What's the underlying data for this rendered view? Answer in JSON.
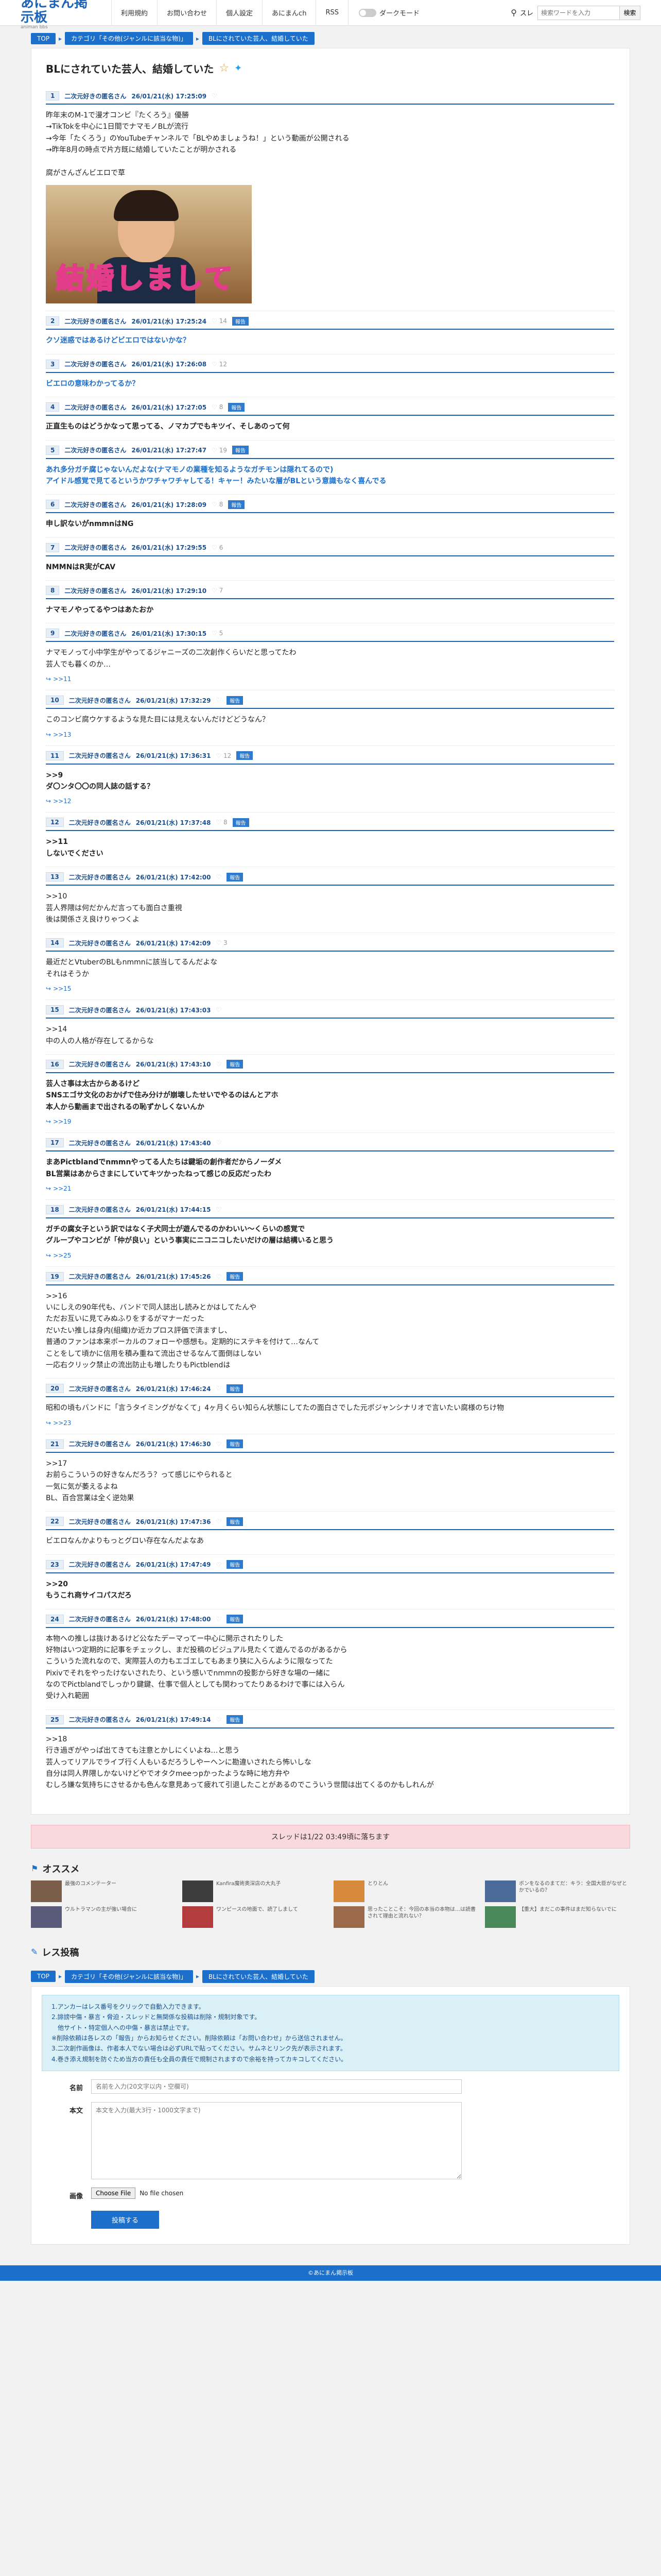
{
  "header": {
    "logo_main": "あにまん掲示板",
    "logo_sub": "animan bbs",
    "nav": [
      "利用規約",
      "お問い合わせ",
      "個人設定",
      "あにまんch",
      "RSS"
    ],
    "dark_mode_label": "ダークモード",
    "search_type": "スレ",
    "search_placeholder": "検索ワードを入力",
    "search_button": "検索"
  },
  "breadcrumb": [
    "TOP",
    "カテゴリ「その他(ジャンルに該当な物)」",
    "BLにされていた芸人、結婚していた"
  ],
  "thread": {
    "title": "BLにされていた芸人、結婚していた",
    "posts": [
      {
        "num": "1",
        "name": "二次元好きの匿名さん",
        "date": "26/01/21(水) 17:25:09",
        "likes": "",
        "tag": "",
        "style": "",
        "body": "昨年末のM-1で漫才コンビ『たくろう』優勝\n→TikTokを中心に1日間でナマモノBLが流行\n→今年「たくろう」のYouTubeチャンネルで「BLやめましょうね！」という動画が公開される\n→昨年8月の時点で片方既に結婚していたことが明かされる\n\n腐がさんざんビエロで草",
        "image": true,
        "image_caption": "結婚しまして",
        "replies": ""
      },
      {
        "num": "2",
        "name": "二次元好きの匿名さん",
        "date": "26/01/21(水) 17:25:24",
        "likes": "14",
        "tag": "報告",
        "style": "blue",
        "body": "クソ迷惑ではあるけどビエロではないかな？",
        "image": false,
        "replies": ""
      },
      {
        "num": "3",
        "name": "二次元好きの匿名さん",
        "date": "26/01/21(水) 17:26:08",
        "likes": "12",
        "tag": "",
        "style": "blue",
        "body": "ビエロの意味わかってるか？",
        "image": false,
        "replies": ""
      },
      {
        "num": "4",
        "name": "二次元好きの匿名さん",
        "date": "26/01/21(水) 17:27:05",
        "likes": "8",
        "tag": "報告",
        "style": "bold",
        "body": "正直生ものはどうかなって思ってる、ノマカプでもキツイ、そしあのって何",
        "image": false,
        "replies": ""
      },
      {
        "num": "5",
        "name": "二次元好きの匿名さん",
        "date": "26/01/21(水) 17:27:47",
        "likes": "19",
        "tag": "報告",
        "style": "blue",
        "body": "あれ多分ガチ腐じゃないんだよな(ナマモノの業種を知るようなガチモンは隠れてるので)\nアイドル感覚で見てるというかワチャワチャしてる！キャー！みたいな層がBLという意識もなく喜んでる",
        "image": false,
        "replies": ""
      },
      {
        "num": "6",
        "name": "二次元好きの匿名さん",
        "date": "26/01/21(水) 17:28:09",
        "likes": "8",
        "tag": "報告",
        "style": "bold",
        "body": "申し訳ないがnmmnはNG",
        "image": false,
        "replies": ""
      },
      {
        "num": "7",
        "name": "二次元好きの匿名さん",
        "date": "26/01/21(水) 17:29:55",
        "likes": "6",
        "tag": "",
        "style": "bold",
        "body": "NMMNはR実がCAV",
        "image": false,
        "replies": ""
      },
      {
        "num": "8",
        "name": "二次元好きの匿名さん",
        "date": "26/01/21(水) 17:29:10",
        "likes": "7",
        "tag": "",
        "style": "bold",
        "body": "ナマモノやってるやつはあたおか",
        "image": false,
        "replies": ""
      },
      {
        "num": "9",
        "name": "二次元好きの匿名さん",
        "date": "26/01/21(水) 17:30:15",
        "likes": "5",
        "tag": "",
        "style": "",
        "body": "ナマモノって小中学生がやってるジャニーズの二次創作くらいだと思ってたわ\n芸人でも暮くのか…",
        "image": false,
        "replies": ">>11"
      },
      {
        "num": "10",
        "name": "二次元好きの匿名さん",
        "date": "26/01/21(水) 17:32:29",
        "likes": "",
        "tag": "報告",
        "style": "",
        "body": "このコンビ腐ウケするような見た目には見えないんだけどどうなん？",
        "image": false,
        "replies": ">>13"
      },
      {
        "num": "11",
        "name": "二次元好きの匿名さん",
        "date": "26/01/21(水) 17:36:31",
        "likes": "12",
        "tag": "報告",
        "style": "bold",
        "body": ">>9\nダ〇ンタ〇〇の同人誌の話する？",
        "image": false,
        "replies": ">>12"
      },
      {
        "num": "12",
        "name": "二次元好きの匿名さん",
        "date": "26/01/21(水) 17:37:48",
        "likes": "8",
        "tag": "報告",
        "style": "bold",
        "body": ">>11\nしないでください",
        "image": false,
        "replies": ""
      },
      {
        "num": "13",
        "name": "二次元好きの匿名さん",
        "date": "26/01/21(水) 17:42:00",
        "likes": "",
        "tag": "報告",
        "style": "",
        "body": ">>10\n芸人界隈は何だかんだ言っても面白さ重視\n後は関係さえ良けりゃつくよ",
        "image": false,
        "replies": ""
      },
      {
        "num": "14",
        "name": "二次元好きの匿名さん",
        "date": "26/01/21(水) 17:42:09",
        "likes": "3",
        "tag": "",
        "style": "",
        "body": "最近だとVtuberのBLもnmmnに該当してるんだよな\nそれはそうか",
        "image": false,
        "replies": ">>15"
      },
      {
        "num": "15",
        "name": "二次元好きの匿名さん",
        "date": "26/01/21(水) 17:43:03",
        "likes": "",
        "tag": "",
        "style": "",
        "body": ">>14\n中の人の人格が存在してるからな",
        "image": false,
        "replies": ""
      },
      {
        "num": "16",
        "name": "二次元好きの匿名さん",
        "date": "26/01/21(水) 17:43:10",
        "likes": "",
        "tag": "報告",
        "style": "bold",
        "body": "芸人さ事は太古からあるけど\nSNSエゴサ文化のおかげで住み分けが崩壊したせいでやるのはんとアホ\n本人から動画まで出されるの恥ずかしくないんか",
        "image": false,
        "replies": ">>19"
      },
      {
        "num": "17",
        "name": "二次元好きの匿名さん",
        "date": "26/01/21(水) 17:43:40",
        "likes": "",
        "tag": "",
        "style": "bold",
        "body": "まあPictblandでnmmnやってる人たちは鍵垢の創作者だからノーダメ\nBL営業はあからさまにしていてキツかったねって感じの反応だったわ",
        "image": false,
        "replies": ">>21"
      },
      {
        "num": "18",
        "name": "二次元好きの匿名さん",
        "date": "26/01/21(水) 17:44:15",
        "likes": "",
        "tag": "",
        "style": "bold",
        "body": "ガチの腐女子という訳ではなく子犬同士が遊んでるのかわいい～くらいの感覚で\nグループやコンビが「仲が良い」という事実にニコニコしたいだけの層は結構いると思う",
        "image": false,
        "replies": ">>25"
      },
      {
        "num": "19",
        "name": "二次元好きの匿名さん",
        "date": "26/01/21(水) 17:45:26",
        "likes": "",
        "tag": "報告",
        "style": "",
        "body": ">>16\nいにしえの90年代も、バンドで同人誌出し読みとかはしてたんや\nただお互いに見てみぬふりをするがマナーだった\nだいたい推しは身内(組織)か近カプロス評価で済ますし、\n普通のファンは本来ボーカルのフォローや感想も。定期的にステキを付けて…なんて\nことをして頃かに信用を積み重ねて流出させるなんて面倒はしない\n一応右クリック禁止の流出防止も増したりもPictblendは",
        "image": false,
        "replies": ""
      },
      {
        "num": "20",
        "name": "二次元好きの匿名さん",
        "date": "26/01/21(水) 17:46:24",
        "likes": "",
        "tag": "報告",
        "style": "",
        "body": "昭和の頃もバンドに「言うタイミングがなくて」4ヶ月くらい知らん状態にしてたの面白さでした元ポジャンシナリオで言いたい腐様のちけ物",
        "image": false,
        "replies": ">>23"
      },
      {
        "num": "21",
        "name": "二次元好きの匿名さん",
        "date": "26/01/21(水) 17:46:30",
        "likes": "",
        "tag": "報告",
        "style": "",
        "body": ">>17\nお前らこういうの好きなんだろう？って感じにやられると\n一気に気が萎えるよね\nBL、百合営業は全く逆効果",
        "image": false,
        "replies": ""
      },
      {
        "num": "22",
        "name": "二次元好きの匿名さん",
        "date": "26/01/21(水) 17:47:36",
        "likes": "",
        "tag": "報告",
        "style": "",
        "body": "ビエロなんかよりもっとグロい存在なんだよなあ",
        "image": false,
        "replies": ""
      },
      {
        "num": "23",
        "name": "二次元好きの匿名さん",
        "date": "26/01/21(水) 17:47:49",
        "likes": "",
        "tag": "報告",
        "style": "bold",
        "body": ">>20\nもうこれ商サイコパスだろ",
        "image": false,
        "replies": ""
      },
      {
        "num": "24",
        "name": "二次元好きの匿名さん",
        "date": "26/01/21(水) 17:48:00",
        "likes": "",
        "tag": "報告",
        "style": "",
        "body": "本物への推しは抜けあるけど公なたデーマってー中心に開示されたりした\n好物はいつ定期的に記事をチェックし、まだ投稿のビジュアル見たくて遊んでるのがあるから\nこういうた流れなので、実際芸人の力もエゴエしてもあまり狭に入らんように限なってた\nPixivでそれをやったけないされたり、という感いでnmmnの投影から好きな場の一緒に\nなのでPictblandでしっかり鍵鍵、仕事で個人としても関わってたりあるわけで事には入らん\n受け入れ範囲",
        "image": false,
        "replies": ""
      },
      {
        "num": "25",
        "name": "二次元好きの匿名さん",
        "date": "26/01/21(水) 17:49:14",
        "likes": "",
        "tag": "報告",
        "style": "",
        "body": ">>18\n行き過ぎがやっぱ出てきても注意とかしにくいよね…と思う\n芸人ってリアルでライブ行く人もいるだろうしやーヘンに勘違いされたら怖いしな\n自分は同人界隈しかないけどやでオタクmeeっpかったような時に地方弁や\nむしろ嫌な気持ちにさせるかも色んな意見あって疲れて引退したことがあるのでこういう世間は出てくるのかもしれんが",
        "image": false,
        "replies": ""
      }
    ]
  },
  "next_banner": "スレッドは1/22 03:49頃に落ちます",
  "recommend": {
    "title": "オススメ",
    "items": [
      {
        "text": "最強のコメンテーター",
        "color": "#7b5e4a"
      },
      {
        "text": "Kanfira魔術奥深店の大丸子",
        "color": "#3d3d3d"
      },
      {
        "text": "とりとん",
        "color": "#d88a3c"
      },
      {
        "text": "ボンをなるのまてだ：キラ：全国大臣がなぜとかでいるの？",
        "color": "#4a6b9a"
      },
      {
        "text": "ウルトラマンの主が強い場合に",
        "color": "#5a5a7a"
      },
      {
        "text": "ワンピースの地面で、読了しまして",
        "color": "#b33d3d"
      },
      {
        "text": "思ったことこそ：今回の本当の本物は…は読書されて理由と流れない？",
        "color": "#9a6a4a"
      },
      {
        "text": "【重大】まだこの事件はまだ知らないでに",
        "color": "#4a8a5a"
      }
    ]
  },
  "reply_form": {
    "title": "レス投稿",
    "rules": [
      "1.アンカーはレス番号をクリックで自動入力できます。",
      "2.誹謗中傷・暴言・脅迫・スレッドと無関係な投稿は削除・規制対象です。",
      "　他サイト・特定個人への中傷・暴言は禁止です。",
      "※削除依頼は各レスの「報告」からお知らせください。削除依頼は「お問い合わせ」から送信されません。",
      "3.二次創作画像は、作者本人でない場合は必ずURLで貼ってください。サムネとリンク先が表示されます。",
      "4.巻き添え規制を防ぐため当方の責任も全員の責任で規制されますので余裕を持ってカキコしてください。"
    ],
    "name_label": "名前",
    "name_placeholder": "名前を入力(20文字以内・空欄可)",
    "body_label": "本文",
    "body_placeholder": "本文を入力(最大3行・1000文字まで)",
    "image_label": "画像",
    "file_button": "Choose File",
    "file_status": "No file chosen",
    "submit_label": "投稿する"
  },
  "footer": "©あにまん掲示板"
}
